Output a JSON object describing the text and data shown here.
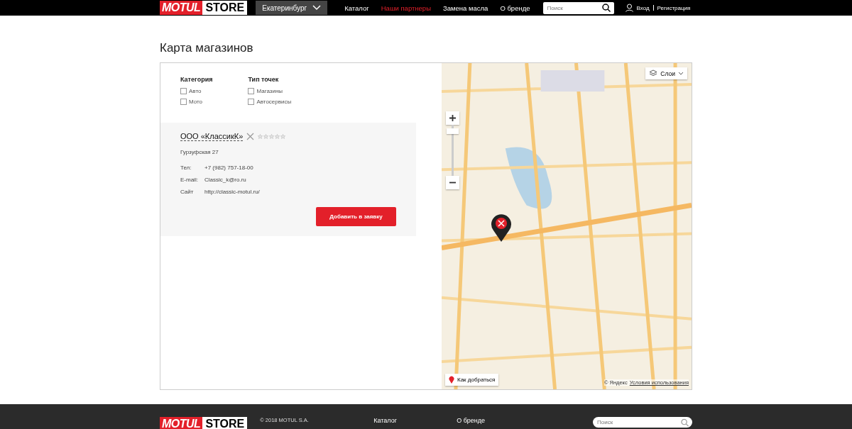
{
  "header": {
    "logo": {
      "brand": "MOTUL",
      "store": "STORE"
    },
    "city": "Екатеринбург",
    "nav": [
      {
        "label": "Каталог",
        "selected": false
      },
      {
        "label": "Наши партнеры",
        "selected": true
      },
      {
        "label": "Замена масла",
        "selected": false
      },
      {
        "label": "О бренде",
        "selected": false
      }
    ],
    "search": {
      "placeholder": "Поиск"
    },
    "login": "Вход",
    "register": "Регистрация"
  },
  "page_title": "Карта магазинов",
  "filters": [
    {
      "title": "Категория",
      "options": [
        {
          "label": "Авто",
          "checked": false
        },
        {
          "label": "Мото",
          "checked": false
        }
      ]
    },
    {
      "title": "Тип точек",
      "options": [
        {
          "label": "Магазины",
          "checked": false
        },
        {
          "label": "Автосервисы",
          "checked": false
        }
      ]
    }
  ],
  "shop": {
    "name": "ООО «КлассикК»",
    "stars": 0,
    "address": "Гурзуфская 27",
    "fields": [
      {
        "label": "Тел:",
        "value": "+7 (982) 757-18-00"
      },
      {
        "label": "E-mail:",
        "value": "Classic_k@ro.ru"
      },
      {
        "label": "Сайт",
        "value": "http://classic-motul.ru/"
      }
    ],
    "button": "Добавить в заявку"
  },
  "map": {
    "layers": "Слои",
    "route": "Как добраться",
    "copyright": "© Яндекс",
    "terms": "Условия использования"
  },
  "footer": {
    "logo": {
      "brand": "MOTUL",
      "store": "STORE"
    },
    "copyright": "© 2018 MOTUL S.A.",
    "links": [
      "Каталог",
      "О бренде"
    ],
    "search": {
      "placeholder": "Поиск"
    }
  }
}
